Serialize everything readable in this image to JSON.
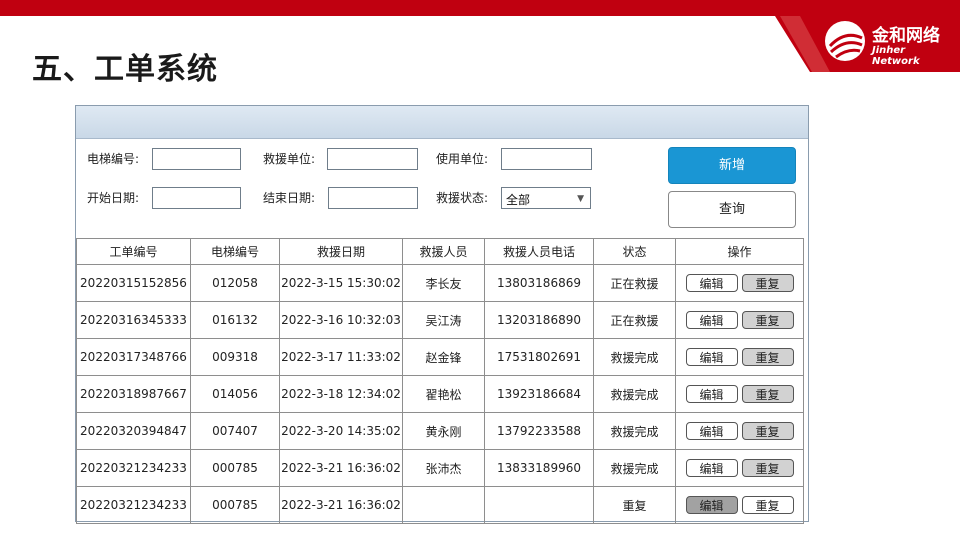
{
  "slide": {
    "title": "五、工单系统"
  },
  "logo": {
    "name": "金和网络",
    "sub": "Jinher Network"
  },
  "colors": {
    "accent_red": "#c00010",
    "button_blue": "#1a96d4"
  },
  "filters": {
    "elevator_no_label": "电梯编号:",
    "rescue_unit_label": "救援单位:",
    "user_unit_label": "使用单位:",
    "start_date_label": "开始日期:",
    "end_date_label": "结束日期:",
    "status_label": "救援状态:",
    "status_value": "全部"
  },
  "buttons": {
    "new": "新增",
    "query": "查询"
  },
  "table": {
    "headers": [
      "工单编号",
      "电梯编号",
      "救援日期",
      "救援人员",
      "救援人员电话",
      "状态",
      "操作"
    ],
    "rows": [
      {
        "order": "20220315152856",
        "elevator": "012058",
        "date": "2022-3-15 15:30:02",
        "person": "李长友",
        "phone": "13803186869",
        "status": "正在救援",
        "edit": "编辑",
        "repeat": "重复"
      },
      {
        "order": "20220316345333",
        "elevator": "016132",
        "date": "2022-3-16 10:32:03",
        "person": "吴江涛",
        "phone": "13203186890",
        "status": "正在救援",
        "edit": "编辑",
        "repeat": "重复"
      },
      {
        "order": "20220317348766",
        "elevator": "009318",
        "date": "2022-3-17 11:33:02",
        "person": "赵金锋",
        "phone": "17531802691",
        "status": "救援完成",
        "edit": "编辑",
        "repeat": "重复"
      },
      {
        "order": "20220318987667",
        "elevator": "014056",
        "date": "2022-3-18 12:34:02",
        "person": "翟艳松",
        "phone": "13923186684",
        "status": "救援完成",
        "edit": "编辑",
        "repeat": "重复"
      },
      {
        "order": "20220320394847",
        "elevator": "007407",
        "date": "2022-3-20 14:35:02",
        "person": "黄永刚",
        "phone": "13792233588",
        "status": "救援完成",
        "edit": "编辑",
        "repeat": "重复"
      },
      {
        "order": "20220321234233",
        "elevator": "000785",
        "date": "2022-3-21 16:36:02",
        "person": "张沛杰",
        "phone": "13833189960",
        "status": "救援完成",
        "edit": "编辑",
        "repeat": "重复"
      },
      {
        "order": "20220321234233",
        "elevator": "000785",
        "date": "2022-3-21 16:36:02",
        "person": "",
        "phone": "",
        "status": "重复",
        "edit": "编辑",
        "repeat": "重复"
      }
    ]
  }
}
